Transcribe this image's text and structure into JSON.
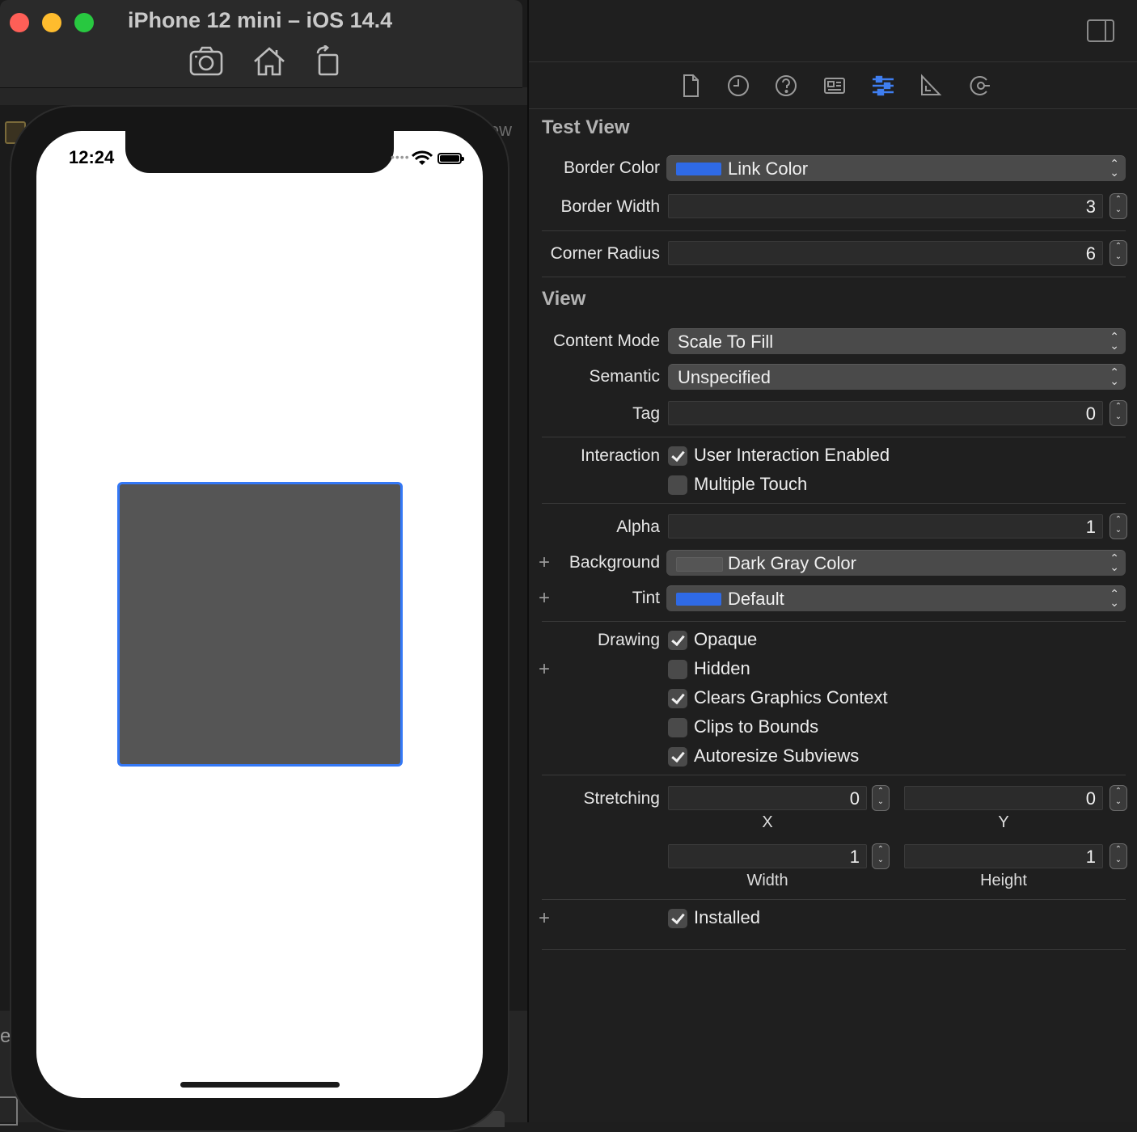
{
  "simulator": {
    "title": "iPhone 12 mini – iOS 14.4",
    "toolbar": [
      "screenshot-icon",
      "home-icon",
      "rotate-icon"
    ],
    "status_time": "12:24",
    "background_tab_fragment": "iew",
    "background_fragment_e": "e"
  },
  "inspector": {
    "tabs": [
      "file-icon",
      "history-icon",
      "help-icon",
      "identity-icon",
      "attributes-icon",
      "size-icon",
      "connections-icon"
    ],
    "active_tab": "attributes-icon",
    "test_view": {
      "title": "Test View",
      "border_color_label": "Border Color",
      "border_color_value": "Link Color",
      "border_color_swatch": "#2f6ae6",
      "border_width_label": "Border Width",
      "border_width_value": "3",
      "corner_radius_label": "Corner Radius",
      "corner_radius_value": "6"
    },
    "view": {
      "title": "View",
      "content_mode_label": "Content Mode",
      "content_mode_value": "Scale To Fill",
      "semantic_label": "Semantic",
      "semantic_value": "Unspecified",
      "tag_label": "Tag",
      "tag_value": "0",
      "interaction_label": "Interaction",
      "user_interaction_label": "User Interaction Enabled",
      "user_interaction_checked": true,
      "multiple_touch_label": "Multiple Touch",
      "multiple_touch_checked": false,
      "alpha_label": "Alpha",
      "alpha_value": "1",
      "background_label": "Background",
      "background_value": "Dark Gray Color",
      "background_swatch": "#555555",
      "tint_label": "Tint",
      "tint_value": "Default",
      "tint_swatch": "#2f6ae6",
      "drawing_label": "Drawing",
      "opaque_label": "Opaque",
      "opaque_checked": true,
      "hidden_label": "Hidden",
      "hidden_checked": false,
      "clears_label": "Clears Graphics Context",
      "clears_checked": true,
      "clips_label": "Clips to Bounds",
      "clips_checked": false,
      "autoresize_label": "Autoresize Subviews",
      "autoresize_checked": true,
      "stretching_label": "Stretching",
      "stretch_x": "0",
      "stretch_y": "0",
      "stretch_width": "1",
      "stretch_height": "1",
      "x_label": "X",
      "y_label": "Y",
      "width_label": "Width",
      "height_label": "Height",
      "installed_label": "Installed",
      "installed_checked": true
    }
  },
  "colors": {
    "accent": "#3478f6",
    "test_view_fill": "#555555"
  }
}
